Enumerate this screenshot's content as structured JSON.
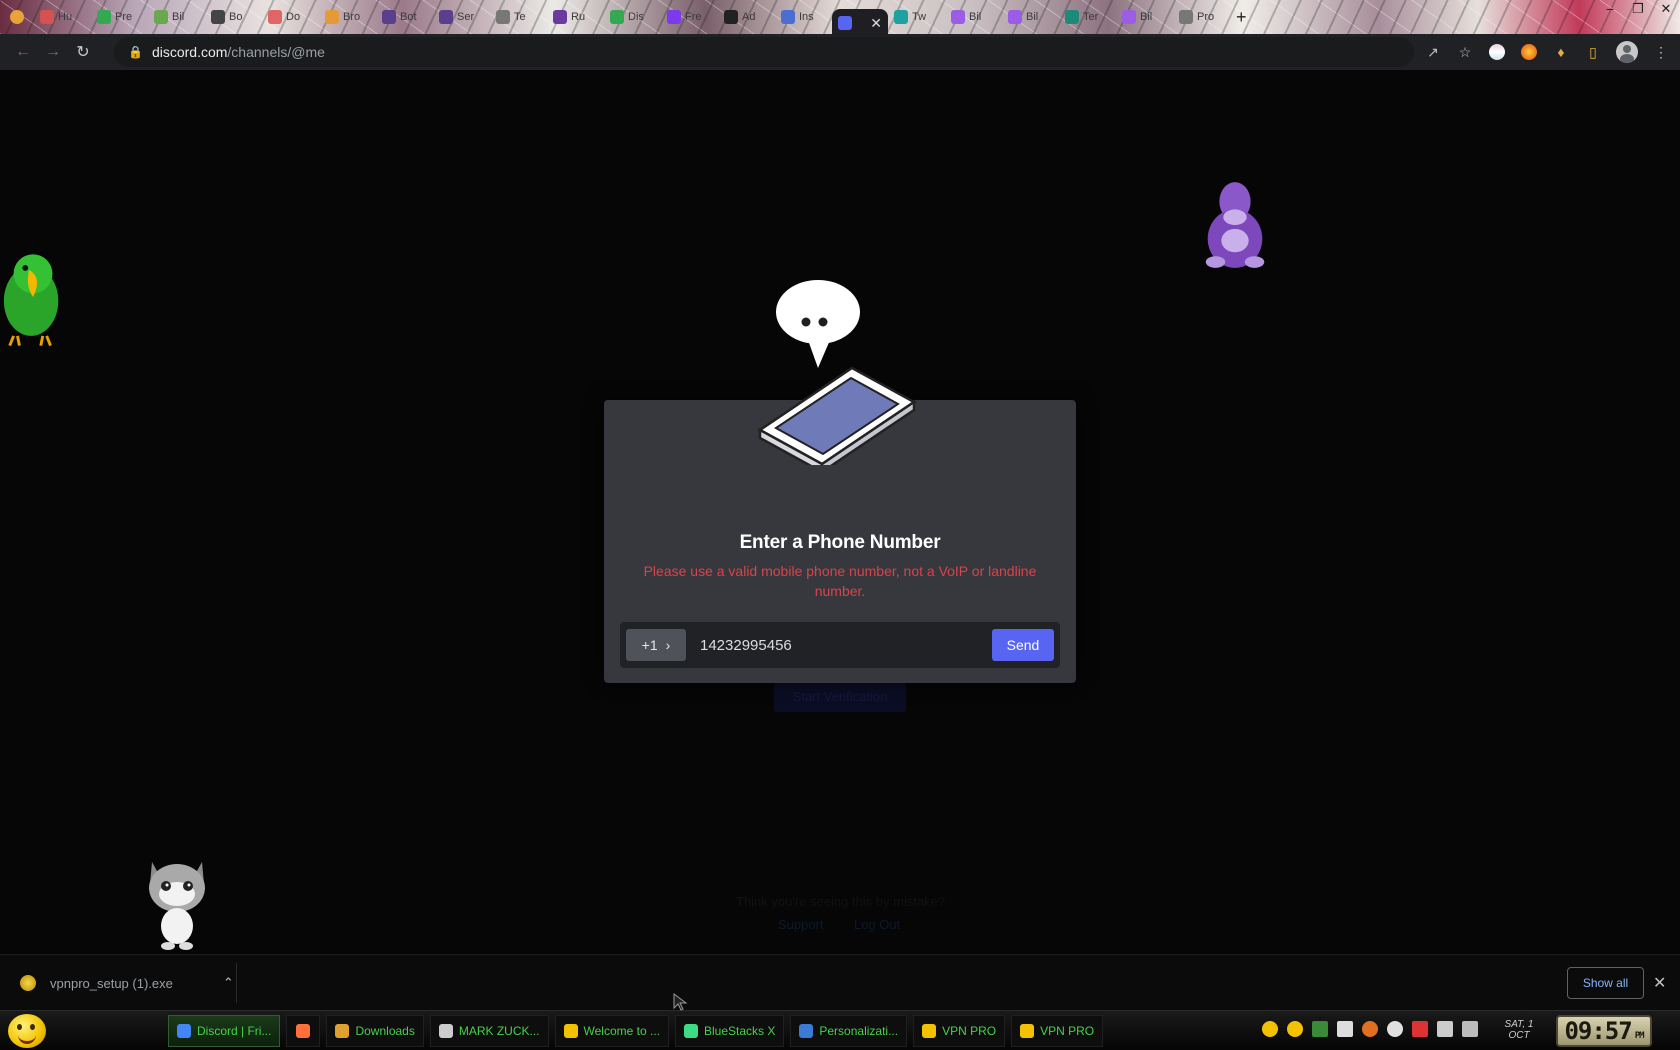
{
  "browser": {
    "tabs": [
      {
        "label": "Hu",
        "color": "#d4524f"
      },
      {
        "label": "Pre",
        "color": "#35a853"
      },
      {
        "label": "Bil",
        "color": "#6aa84f"
      },
      {
        "label": "Bo",
        "color": "#444444"
      },
      {
        "label": "Do",
        "color": "#e06666"
      },
      {
        "label": "Bro",
        "color": "#e59a3a"
      },
      {
        "label": "Bot",
        "color": "#5b3f8c"
      },
      {
        "label": "Ser",
        "color": "#5b3f8c"
      },
      {
        "label": "Te",
        "color": "#777777"
      },
      {
        "label": "Ru",
        "color": "#6a3aa0"
      },
      {
        "label": "Dis",
        "color": "#35a853"
      },
      {
        "label": "Fre",
        "color": "#7c3aed"
      },
      {
        "label": "Ad",
        "color": "#222222"
      },
      {
        "label": "Ins",
        "color": "#4a6fd1"
      },
      {
        "label": "",
        "color": "#5865f2",
        "active": true
      },
      {
        "label": "Tw",
        "color": "#1da1a1"
      },
      {
        "label": "Bil",
        "color": "#9b5de5"
      },
      {
        "label": "Bil",
        "color": "#9b5de5"
      },
      {
        "label": "Ter",
        "color": "#1d8a7a"
      },
      {
        "label": "Bil",
        "color": "#9b5de5"
      },
      {
        "label": "Pro",
        "color": "#777777"
      }
    ],
    "active_tab_close": "✕",
    "window_controls": [
      "–",
      "❐",
      "✕"
    ],
    "url_host": "discord.com",
    "url_path": "/channels/@me"
  },
  "page": {
    "ghost_button": "Start Verification",
    "ghost_mistake": "Think you're seeing this by mistake?",
    "ghost_support": "Support",
    "ghost_logout": "Log Out"
  },
  "modal": {
    "title": "Enter a Phone Number",
    "error": "Please use a valid mobile phone number, not a VoIP or landline number.",
    "country_code": "+1",
    "phone_value": "14232995456",
    "send_label": "Send"
  },
  "colors": {
    "accent": "#5865f2",
    "error": "#d9434b",
    "modal_bg": "#36383d",
    "taskbar_text": "#47d14b"
  },
  "downloads": {
    "file": "vpnpro_setup (1).exe",
    "show_all": "Show all",
    "close": "✕"
  },
  "taskbar": {
    "items": [
      {
        "label": "Discord | Fri...",
        "color": "#4285f4",
        "active": true
      },
      {
        "label": "",
        "color": "#ff7139"
      },
      {
        "label": "Downloads",
        "color": "#e0a030"
      },
      {
        "label": "MARK ZUCK...",
        "color": "#cccccc"
      },
      {
        "label": "Welcome to ...",
        "color": "#f2c200"
      },
      {
        "label": "BlueStacks X",
        "color": "#3ddc84"
      },
      {
        "label": "Personalizati...",
        "color": "#3a7bd5"
      },
      {
        "label": "VPN PRO",
        "color": "#f2c200"
      },
      {
        "label": "VPN PRO",
        "color": "#f2c200"
      }
    ],
    "date_line1": "SAT, 1",
    "date_line2": "OCT",
    "time": "09:57",
    "ampm": "PM"
  }
}
